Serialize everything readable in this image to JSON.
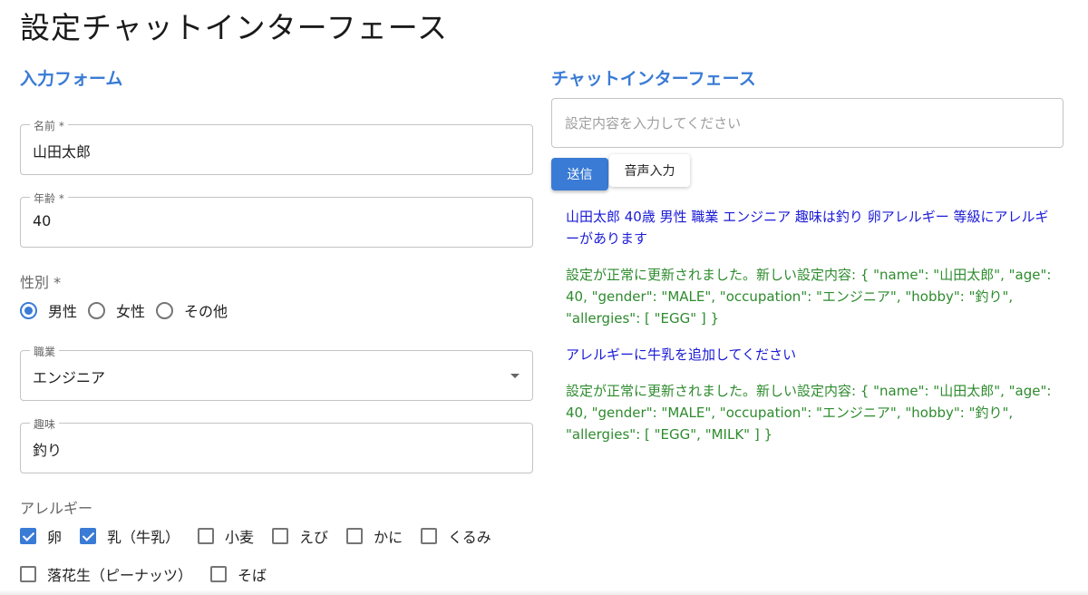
{
  "page": {
    "title": "設定チャットインターフェース"
  },
  "form": {
    "section_title": "入力フォーム",
    "name": {
      "label": "名前 *",
      "value": "山田太郎"
    },
    "age": {
      "label": "年齢 *",
      "value": "40"
    },
    "gender": {
      "label": "性別 *",
      "options": [
        "男性",
        "女性",
        "その他"
      ],
      "selected": "男性"
    },
    "occupation": {
      "label": "職業",
      "value": "エンジニア"
    },
    "hobby": {
      "label": "趣味",
      "value": "釣り"
    },
    "allergies": {
      "label": "アレルギー",
      "options": [
        {
          "label": "卵",
          "checked": true
        },
        {
          "label": "乳（牛乳）",
          "checked": true
        },
        {
          "label": "小麦",
          "checked": false
        },
        {
          "label": "えび",
          "checked": false
        },
        {
          "label": "かに",
          "checked": false
        },
        {
          "label": "くるみ",
          "checked": false
        },
        {
          "label": "落花生（ピーナッツ）",
          "checked": false
        },
        {
          "label": "そば",
          "checked": false
        }
      ]
    }
  },
  "chat": {
    "section_title": "チャットインターフェース",
    "input_placeholder": "設定内容を入力してください",
    "send_label": "送信",
    "voice_label": "音声入力",
    "messages": [
      {
        "role": "user",
        "text": "山田太郎 40歳 男性 職業 エンジニア 趣味は釣り 卵アレルギー 等級にアレルギーがあります"
      },
      {
        "role": "system",
        "text": "設定が正常に更新されました。新しい設定内容: { \"name\": \"山田太郎\", \"age\": 40, \"gender\": \"MALE\", \"occupation\": \"エンジニア\", \"hobby\": \"釣り\", \"allergies\": [ \"EGG\" ] }"
      },
      {
        "role": "user",
        "text": "アレルギーに牛乳を追加してください"
      },
      {
        "role": "system",
        "text": "設定が正常に更新されました。新しい設定内容: { \"name\": \"山田太郎\", \"age\": 40, \"gender\": \"MALE\", \"occupation\": \"エンジニア\", \"hobby\": \"釣り\", \"allergies\": [ \"EGG\", \"MILK\" ] }"
      }
    ]
  },
  "colors": {
    "accent": "#3a7bd5",
    "user_message": "#1a1ad6",
    "system_message": "#2e8b2e"
  }
}
